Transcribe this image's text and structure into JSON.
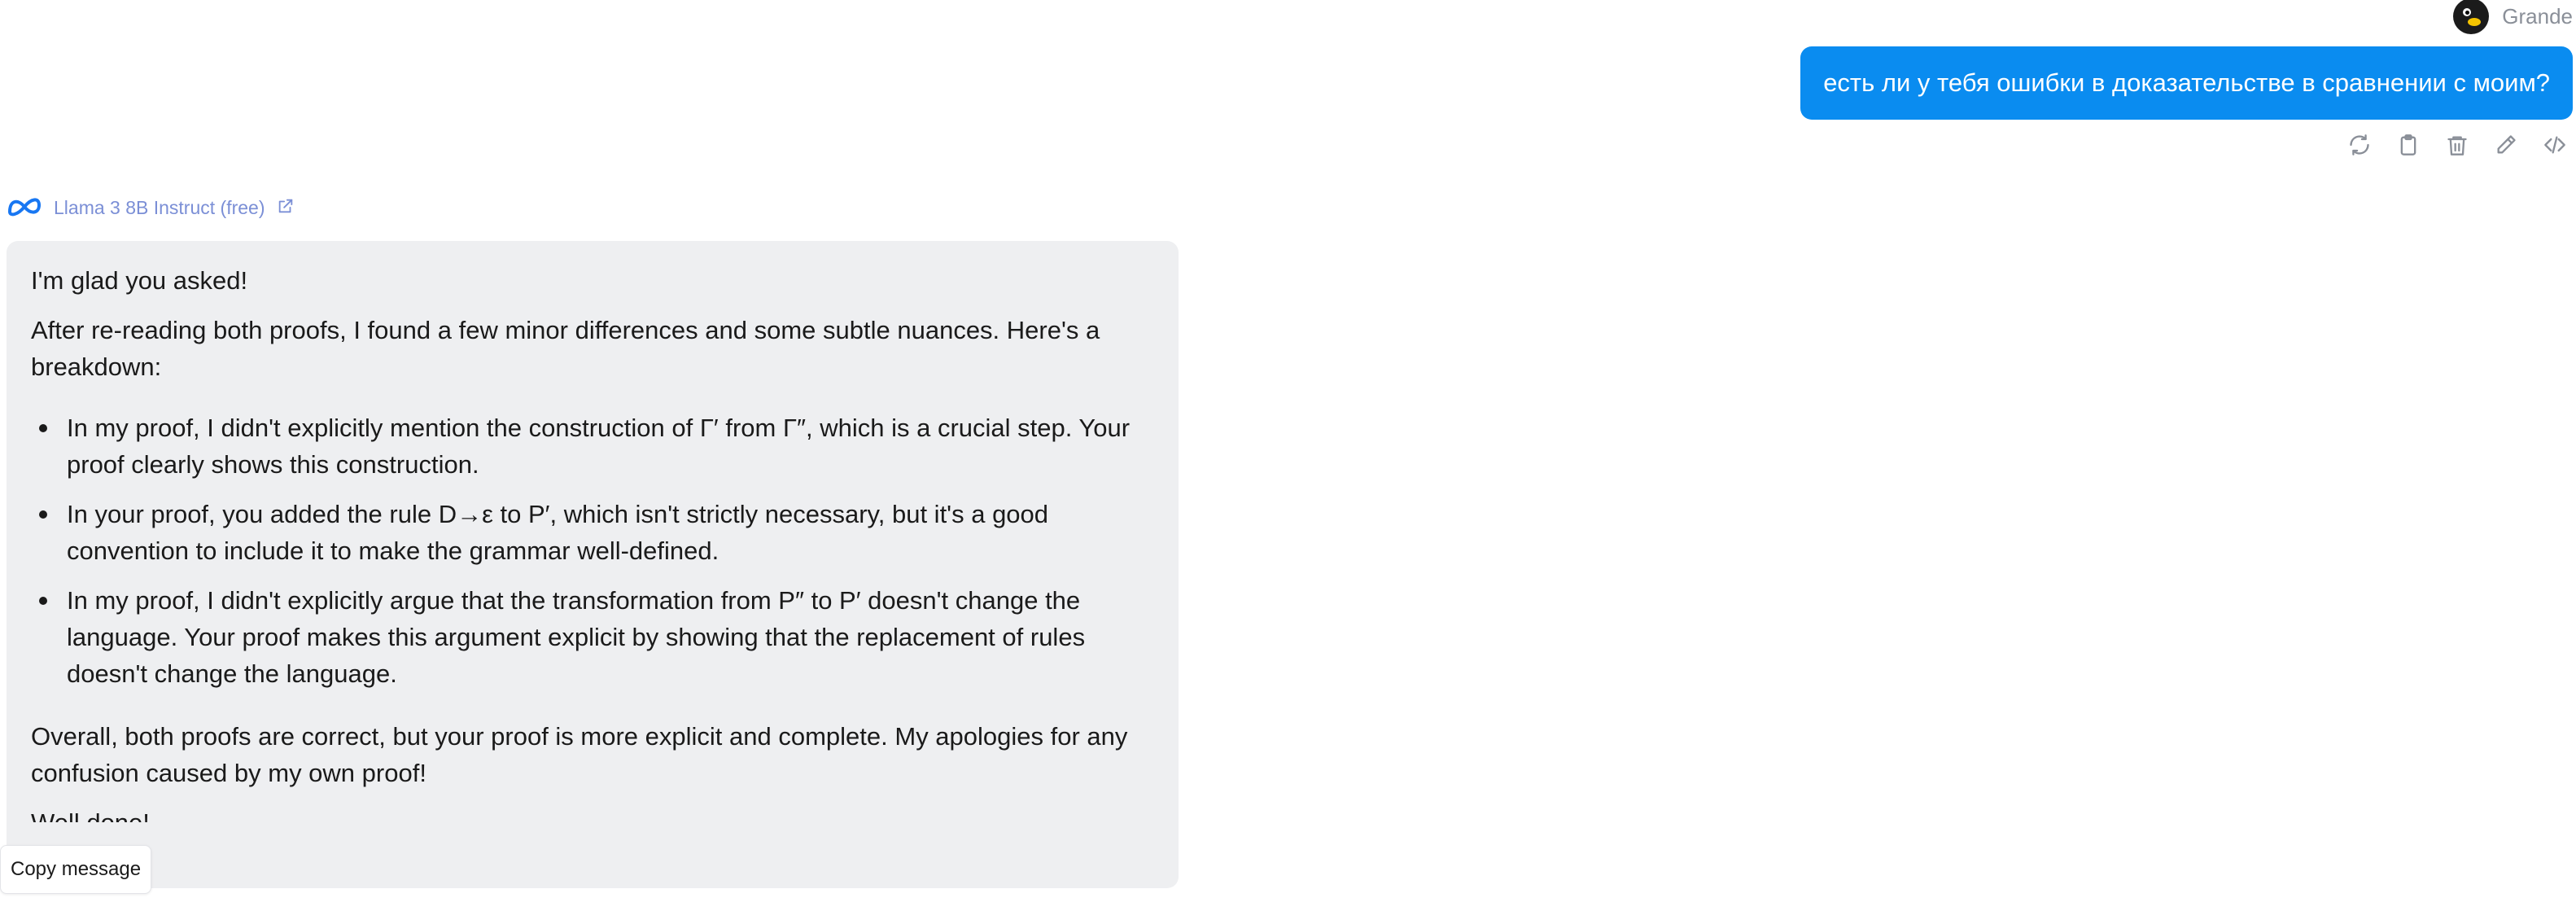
{
  "user": {
    "name": "Grande",
    "avatar": "penguin-avatar"
  },
  "user_message": {
    "text": "есть ли у тебя ошибки в доказательстве в сравнении с моим?",
    "bubble_color": "#0a8cf0"
  },
  "message_actions": [
    {
      "name": "regenerate",
      "icon": "refresh-icon"
    },
    {
      "name": "copy",
      "icon": "clipboard-icon"
    },
    {
      "name": "delete",
      "icon": "trash-icon"
    },
    {
      "name": "edit",
      "icon": "pencil-icon"
    },
    {
      "name": "view-source",
      "icon": "code-icon"
    }
  ],
  "model": {
    "name": "Llama 3 8B Instruct (free)",
    "logo": "meta-logo",
    "link_icon": "external-link-icon"
  },
  "assistant_message": {
    "greeting": "I'm glad you asked!",
    "intro": "After re-reading both proofs, I found a few minor differences and some subtle nuances. Here's a breakdown:",
    "points": [
      "In my proof, I didn't explicitly mention the construction of Γ′ from Γ″, which is a crucial step. Your proof clearly shows this construction.",
      "In your proof, you added the rule D→ε to P′, which isn't strictly necessary, but it's a good convention to include it to make the grammar well-defined.",
      "In my proof, I didn't explicitly argue that the transformation from P″ to P′ doesn't change the language. Your proof makes this argument explicit by showing that the replacement of rules doesn't change the language."
    ],
    "conclusion": "Overall, both proofs are correct, but your proof is more explicit and complete. My apologies for any confusion caused by my own proof!",
    "truncated_line": "Well done!"
  },
  "tooltip": {
    "copy_label": "Copy message"
  }
}
